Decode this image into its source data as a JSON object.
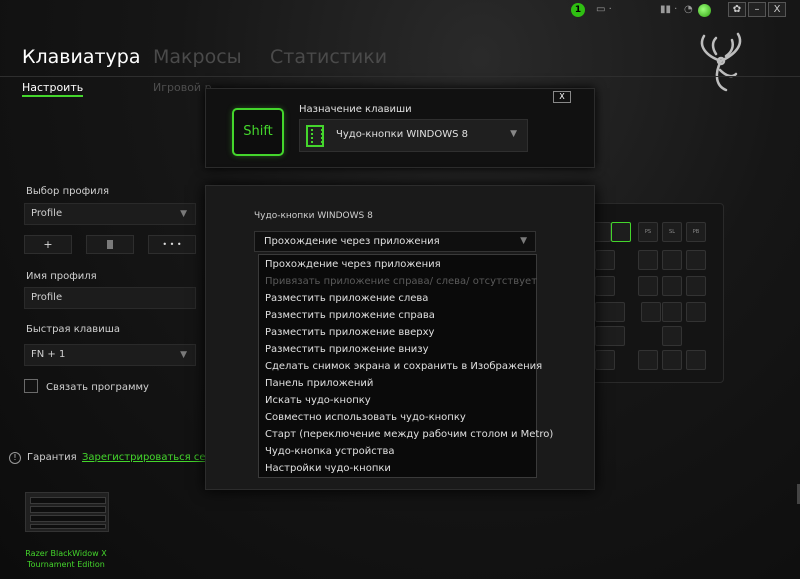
{
  "topbar": {
    "notification_count": "1",
    "window_buttons": [
      "✿",
      "–",
      "X"
    ]
  },
  "tabs": [
    "Клавиатура",
    "Макросы",
    "Статистики"
  ],
  "subtabs": [
    "Настроить",
    "Игровой р"
  ],
  "left": {
    "profile_label": "Выбор профиля",
    "profile_value": "Profile",
    "add_button": "+",
    "delete_button": "🗑",
    "more_button": "• • •",
    "profile_name_label": "Имя профиля",
    "profile_name_value": "Profile",
    "hotkey_label": "Быстрая клавиша",
    "hotkey_value": "FN + 1",
    "link_program_label": "Связать программу",
    "warranty_label": "Гарантия",
    "register_link": "Зарегистрироваться сей"
  },
  "device": {
    "name": "Razer BlackWidow X Tournament Edition"
  },
  "dialog": {
    "close": "X",
    "key_label": "Shift",
    "assign_title": "Назначение клавиши",
    "assign_value": "Чудо-кнопки WINDOWS 8",
    "sub_label": "Чудо-кнопки WINDOWS 8",
    "sub_value": "Прохождение через приложения",
    "options": [
      {
        "label": "Прохождение через приложения",
        "disabled": false
      },
      {
        "label": "Привязать приложение справа/ слева/ отсутствует",
        "disabled": true
      },
      {
        "label": "Разместить приложение слева",
        "disabled": false
      },
      {
        "label": "Разместить приложение справа",
        "disabled": false
      },
      {
        "label": "Разместить приложение вверху",
        "disabled": false
      },
      {
        "label": "Разместить приложение внизу",
        "disabled": false
      },
      {
        "label": "Сделать снимок экрана и сохранить в Изображения",
        "disabled": false
      },
      {
        "label": "Панель приложений",
        "disabled": false
      },
      {
        "label": "Искать чудо-кнопку",
        "disabled": false
      },
      {
        "label": "Совместно использовать чудо-кнопку",
        "disabled": false
      },
      {
        "label": "Старт (переключение между рабочим столом и Metro)",
        "disabled": false
      },
      {
        "label": "Чудо-кнопка устройства",
        "disabled": false
      },
      {
        "label": "Настройки чудо-кнопки",
        "disabled": false
      }
    ]
  },
  "background_keys": [
    {
      "label": "",
      "green": false
    },
    {
      "label": "",
      "green": true
    },
    {
      "label": "PS",
      "green": false
    },
    {
      "label": "SL",
      "green": false
    },
    {
      "label": "PB",
      "green": false
    },
    {
      "label": "",
      "green": false
    },
    {
      "label": "",
      "green": false
    },
    {
      "label": "",
      "green": false
    },
    {
      "label": "",
      "green": false
    },
    {
      "label": "",
      "green": false
    }
  ],
  "colors": {
    "accent": "#44d62c",
    "background": "#111111"
  }
}
